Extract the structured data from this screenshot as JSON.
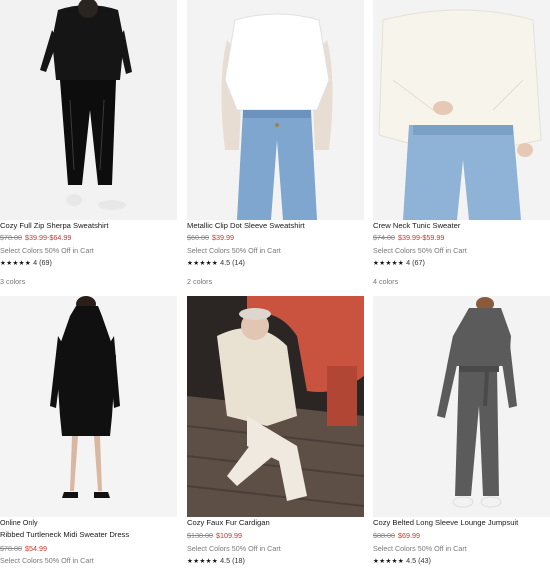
{
  "products": [
    {
      "badge": "",
      "name": "Cozy Full Zip Sherpa Sweatshirt",
      "was": "$78.00",
      "now": "$39.99-$64.99",
      "promo": "Select Colors 50% Off in Cart",
      "stars": "★★★★★",
      "rating_text": "4 (69)",
      "colors": "3 colors"
    },
    {
      "badge": "",
      "name": "Metallic Clip Dot Sleeve Sweatshirt",
      "was": "$60.00",
      "now": "$39.99",
      "promo": "Select Colors 50% Off in Cart",
      "stars": "★★★★★",
      "rating_text": "4.5 (14)",
      "colors": "2 colors"
    },
    {
      "badge": "",
      "name": "Crew Neck Tunic Sweater",
      "was": "$74.00",
      "now": "$39.99-$59.99",
      "promo": "Select Colors 50% Off in Cart",
      "stars": "★★★★★",
      "rating_text": "4 (67)",
      "colors": "4 colors"
    },
    {
      "badge": "Online Only",
      "name": "Ribbed Turtleneck Midi Sweater Dress",
      "was": "$78.00",
      "now": "$54.99",
      "promo": "Select Colors 50% Off in Cart",
      "stars": "",
      "rating_text": "",
      "colors": ""
    },
    {
      "badge": "",
      "name": "Cozy Faux Fur Cardigan",
      "was": "$138.00",
      "now": "$109.99",
      "promo": "Select Colors 50% Off in Cart",
      "stars": "★★★★★",
      "rating_text": "4.5 (18)",
      "colors": ""
    },
    {
      "badge": "",
      "name": "Cozy Belted Long Sleeve Lounge Jumpsuit",
      "was": "$88.00",
      "now": "$69.99",
      "promo": "Select Colors 50% Off in Cart",
      "stars": "★★★★★",
      "rating_text": "4.5 (43)",
      "colors": ""
    }
  ]
}
